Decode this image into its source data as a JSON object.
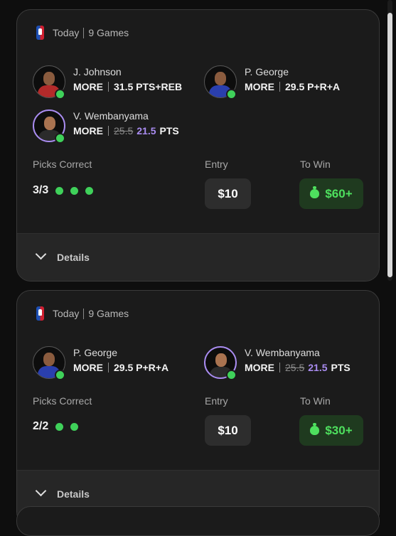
{
  "colors": {
    "accent_green": "#3fd15a",
    "accent_purple": "#a98cf0",
    "win_bg": "#1f3a1f"
  },
  "cards": [
    {
      "header": {
        "league_icon": "nba-logo-icon",
        "day": "Today",
        "games": "9 Games"
      },
      "players": [
        {
          "name": "J. Johnson",
          "direction": "MORE",
          "line": "31.5",
          "stat": "PTS+REB"
        },
        {
          "name": "P. George",
          "direction": "MORE",
          "line": "29.5",
          "stat": "P+R+A"
        },
        {
          "name": "V. Wembanyama",
          "direction": "MORE",
          "old_line": "25.5",
          "line": "21.5",
          "stat": "PTS"
        }
      ],
      "picks_label": "Picks Correct",
      "picks_value": "3/3",
      "entry_label": "Entry",
      "entry_value": "$10",
      "win_label": "To Win",
      "win_value": "$60+",
      "details_label": "Details"
    },
    {
      "header": {
        "league_icon": "nba-logo-icon",
        "day": "Today",
        "games": "9 Games"
      },
      "players": [
        {
          "name": "P. George",
          "direction": "MORE",
          "line": "29.5",
          "stat": "P+R+A"
        },
        {
          "name": "V. Wembanyama",
          "direction": "MORE",
          "old_line": "25.5",
          "line": "21.5",
          "stat": "PTS"
        }
      ],
      "picks_label": "Picks Correct",
      "picks_value": "2/2",
      "entry_label": "Entry",
      "entry_value": "$10",
      "win_label": "To Win",
      "win_value": "$30+",
      "details_label": "Details"
    }
  ]
}
